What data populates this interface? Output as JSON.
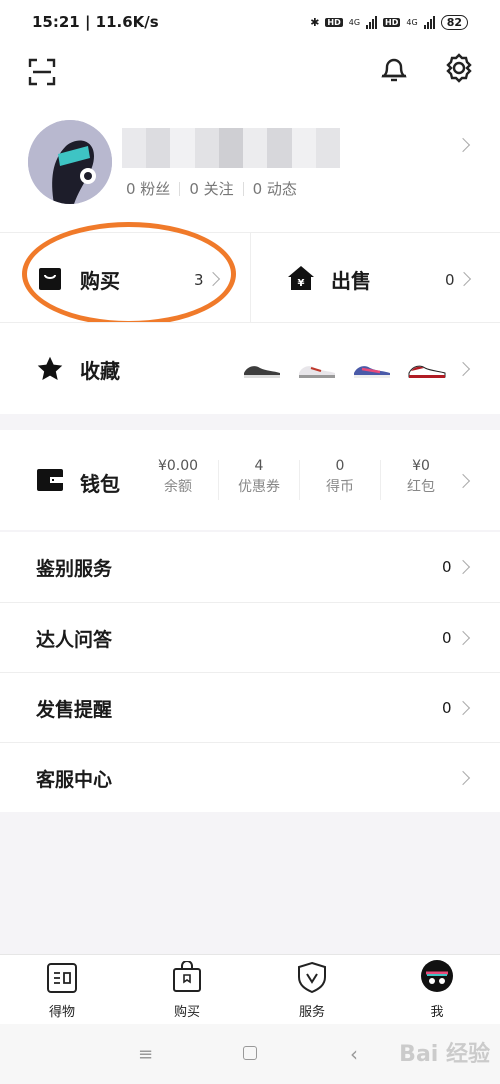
{
  "status": {
    "time_speed": "15:21 | 11.6K/s",
    "net1": "4G",
    "net2": "4G",
    "hd": "HD",
    "battery": "82"
  },
  "topbar": {
    "scan_icon": "scan-icon",
    "bell_icon": "bell-icon",
    "settings_icon": "gear-icon"
  },
  "profile": {
    "fans": "0 粉丝",
    "following": "0 关注",
    "posts": "0 动态"
  },
  "buy": {
    "label": "购买",
    "count": "3"
  },
  "sell": {
    "label": "出售",
    "count": "0"
  },
  "favorites": {
    "label": "收藏"
  },
  "wallet": {
    "label": "钱包",
    "stats": [
      {
        "value": "¥0.00",
        "label": "余额"
      },
      {
        "value": "4",
        "label": "优惠券"
      },
      {
        "value": "0",
        "label": "得币"
      },
      {
        "value": "¥0",
        "label": "红包"
      }
    ]
  },
  "list": [
    {
      "label": "鉴别服务",
      "count": "0"
    },
    {
      "label": "达人问答",
      "count": "0"
    },
    {
      "label": "发售提醒",
      "count": "0"
    },
    {
      "label": "客服中心",
      "count": ""
    }
  ],
  "tabs": [
    {
      "label": "得物",
      "icon": "dewu-logo-icon"
    },
    {
      "label": "购买",
      "icon": "shopping-bag-icon"
    },
    {
      "label": "服务",
      "icon": "shield-icon"
    },
    {
      "label": "我",
      "icon": "avatar-icon"
    }
  ],
  "navbar": {
    "watermark": "Bai 经验"
  },
  "colors": {
    "accent_circle": "#f07a2a",
    "text": "#1a1a1a"
  }
}
